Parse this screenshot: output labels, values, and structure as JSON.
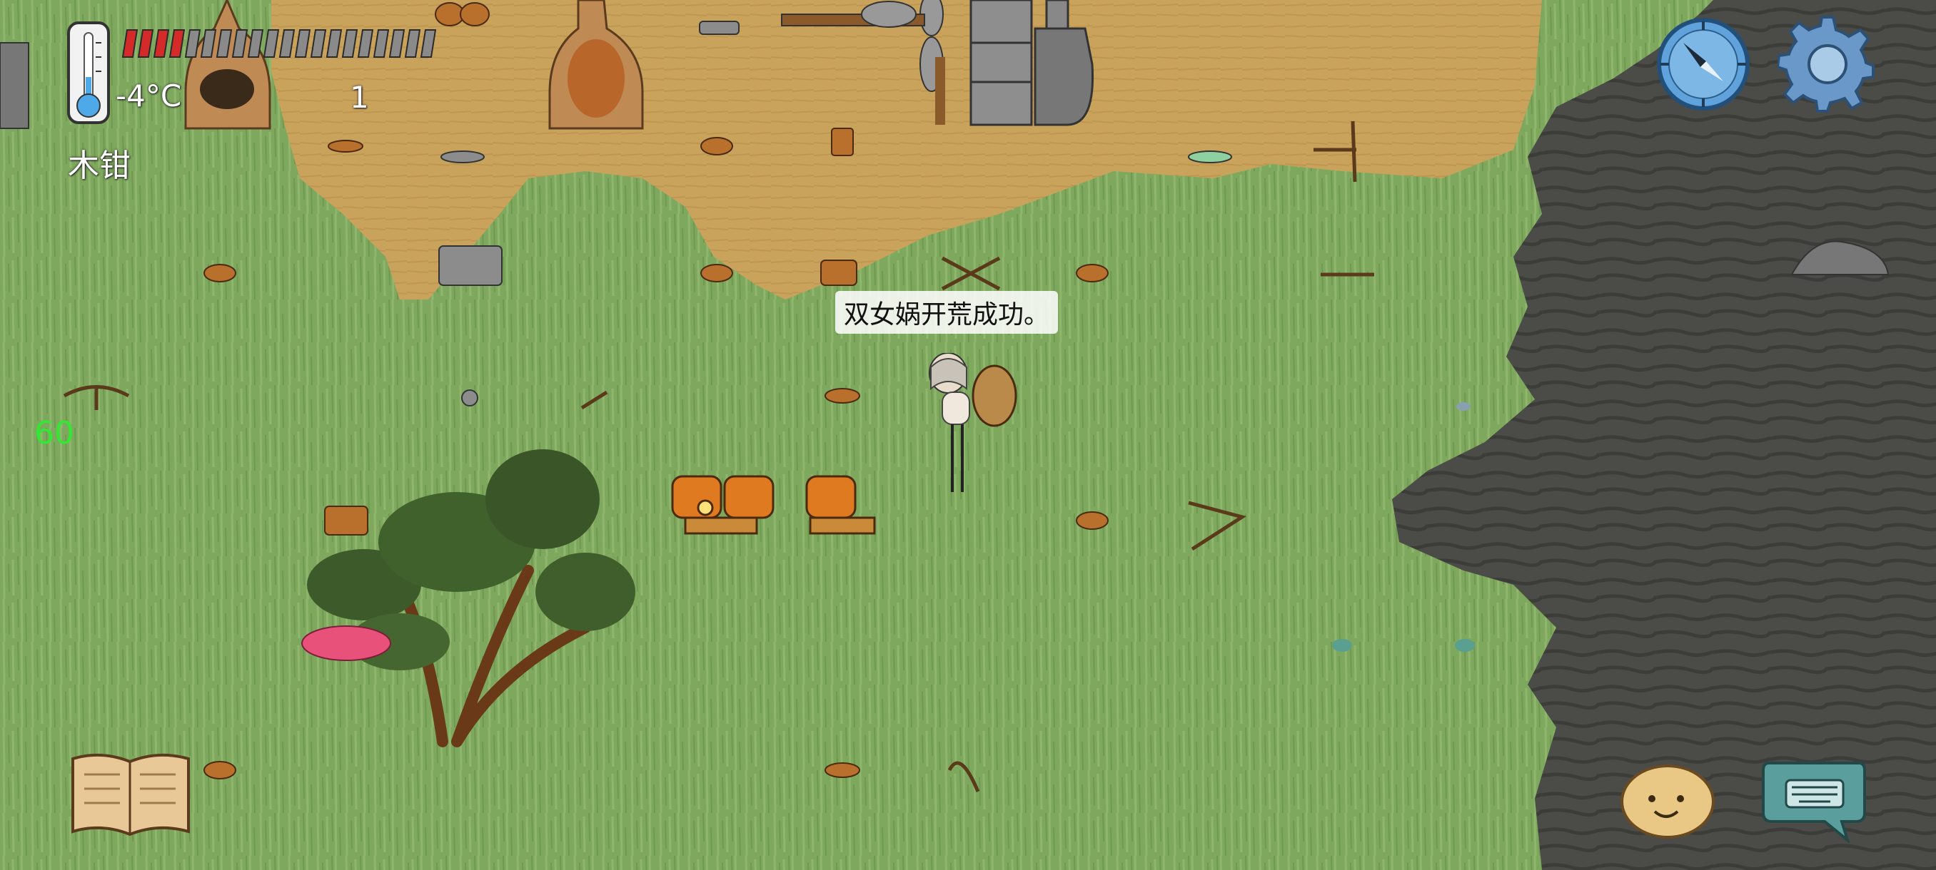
{
  "hud": {
    "temperature": "-4°C",
    "held_item": "木钳",
    "counter": "1",
    "fps": "60",
    "food_filled_pips": 4,
    "food_total_pips": 20,
    "colors": {
      "food_full": "#d42a2a",
      "food_empty": "#8a8a8a",
      "fps": "#33e833"
    }
  },
  "speech": {
    "text": "双女娲开荒成功。"
  },
  "icons": {
    "thermometer": "thermometer-icon",
    "compass": "compass-icon",
    "settings": "gear-icon",
    "book": "book-icon",
    "emote": "emote-face-icon",
    "keyboard": "keyboard-icon"
  },
  "colors": {
    "grass": "#7aa35a",
    "dirt": "#c8a25a",
    "swamp": "#4a4a46",
    "accent_blue": "#3c7fc0"
  }
}
